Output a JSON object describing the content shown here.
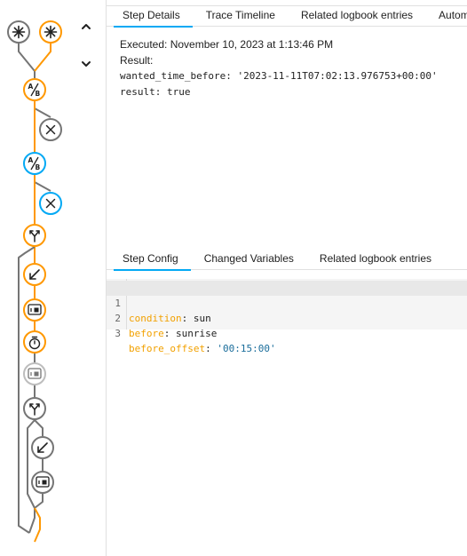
{
  "colors": {
    "accent": "#03a9f4",
    "trace_active": "#ff9800",
    "trace_inactive": "#757575",
    "trace_disabled": "#bdbdbd"
  },
  "icons": {
    "trigger_1": "asterisk-icon",
    "trigger_2": "asterisk-icon",
    "condition_1": "ab-icon",
    "condition_1_fail": "close-icon",
    "condition_2": "ab-icon",
    "condition_2_fail": "close-icon",
    "choose_1": "arrow-split-icon",
    "action_1": "arrow-down-left-icon",
    "action_2": "device-icon",
    "action_3": "timer-icon",
    "action_4": "device-icon",
    "choose_2": "arrow-split-icon",
    "action_5": "arrow-down-left-icon",
    "action_6": "device-icon",
    "nav_up": "chevron-up-icon",
    "nav_down": "chevron-down-icon"
  },
  "tabs_top": [
    {
      "label": "Step Details",
      "active": true
    },
    {
      "label": "Trace Timeline",
      "active": false
    },
    {
      "label": "Related logbook entries",
      "active": false
    },
    {
      "label": "Autom",
      "active": false
    }
  ],
  "details": {
    "executed": "Executed: November 10, 2023 at 1:13:46 PM",
    "result_label": "Result:",
    "line1": "wanted_time_before: '2023-11-11T07:02:13.976753+00:00'",
    "line2": "result: true"
  },
  "tabs_config": [
    {
      "label": "Step Config",
      "active": true
    },
    {
      "label": "Changed Variables",
      "active": false
    },
    {
      "label": "Related logbook entries",
      "active": false
    }
  ],
  "config": {
    "lines": [
      {
        "num": "1",
        "key": "condition",
        "sep": ": ",
        "val": "sun"
      },
      {
        "num": "2",
        "key": "before",
        "sep": ": ",
        "val": "sunrise"
      },
      {
        "num": "3",
        "key": "before_offset",
        "sep": ": ",
        "val": "'00:15:00'"
      }
    ]
  }
}
